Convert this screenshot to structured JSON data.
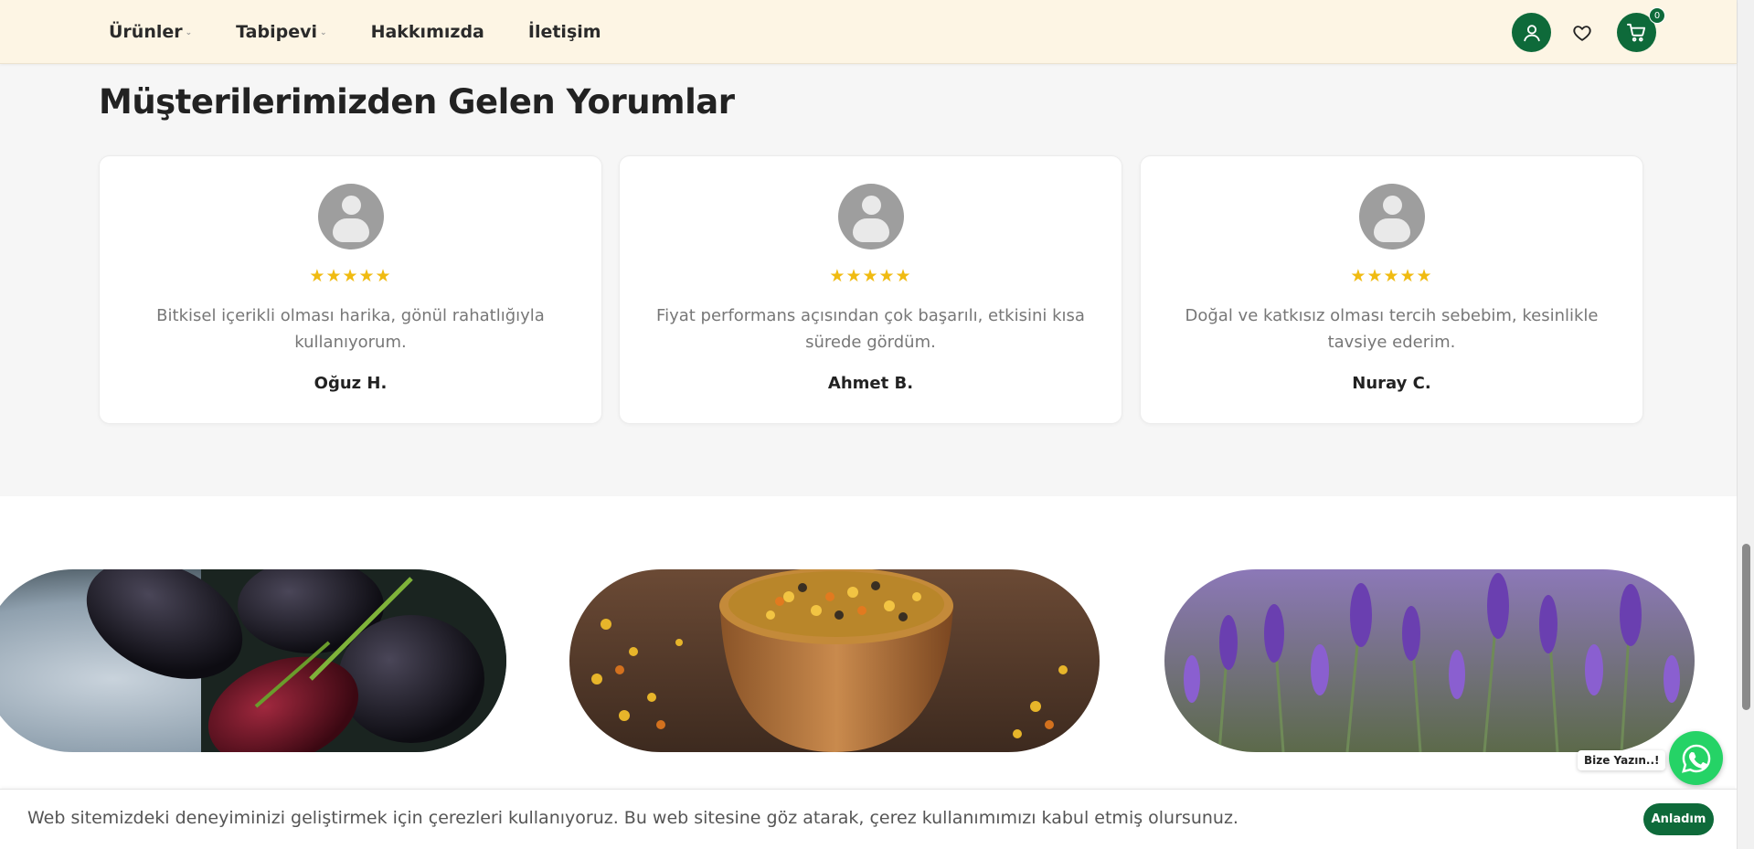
{
  "header": {
    "nav": [
      {
        "label": "Ürünler",
        "has_dropdown": true
      },
      {
        "label": "Tabipevi",
        "has_dropdown": true
      },
      {
        "label": "Hakkımızda",
        "has_dropdown": false
      },
      {
        "label": "İletişim",
        "has_dropdown": false
      }
    ],
    "actions": {
      "account_icon": "user-icon",
      "wishlist_icon": "heart-icon",
      "cart_icon": "cart-icon",
      "cart_count": "0"
    },
    "brand_color": "#0e6a3a",
    "background": "#fdf5e4"
  },
  "reviews": {
    "title": "Müşterilerimizden Gelen Yorumlar",
    "items": [
      {
        "stars": "★★★★★",
        "rating": 5,
        "text": "Bitkisel içerikli olması harika, gönül rahatlığıyla kullanıyorum.",
        "name": "Oğuz H."
      },
      {
        "stars": "★★★★★",
        "rating": 5,
        "text": "Fiyat performans açısından çok başarılı, etkisini kısa sürede gördüm.",
        "name": "Ahmet B."
      },
      {
        "stars": "★★★★★",
        "rating": 5,
        "text": "Doğal ve katkısız olması tercih sebebim, kesinlikle tavsiye ederim.",
        "name": "Nuray C."
      }
    ],
    "star_color": "#f0bb12"
  },
  "gallery": {
    "images": [
      {
        "subject": "mulberries"
      },
      {
        "subject": "bee-pollen-bowl"
      },
      {
        "subject": "lavender-field"
      }
    ]
  },
  "whatsapp": {
    "label": "Bize Yazın..!",
    "icon": "whatsapp-icon",
    "color": "#25d366"
  },
  "cookie": {
    "text": "Web sitemizdeki deneyiminizi geliştirmek için çerezleri kullanıyoruz. Bu web sitesine göz atarak, çerez kullanımımızı kabul etmiş olursunuz.",
    "button": "Anladım"
  }
}
